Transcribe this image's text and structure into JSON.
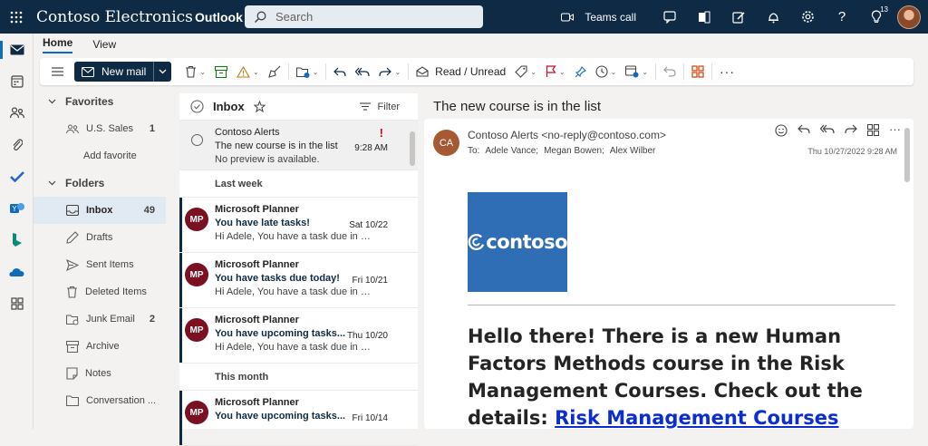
{
  "header": {
    "brand": "Contoso Electronics",
    "app": "Outlook",
    "search_placeholder": "Search",
    "teams_call": "Teams call",
    "notification_badge": "13"
  },
  "ribbon": {
    "tabs": [
      "Home",
      "View"
    ],
    "new_mail": "New mail",
    "read_unread": "Read / Unread"
  },
  "folders": {
    "favorites_label": "Favorites",
    "favorites": [
      {
        "label": "U.S. Sales",
        "count": "1"
      },
      {
        "label": "Add favorite",
        "count": ""
      }
    ],
    "folders_label": "Folders",
    "items": [
      {
        "label": "Inbox",
        "count": "49"
      },
      {
        "label": "Drafts",
        "count": ""
      },
      {
        "label": "Sent Items",
        "count": ""
      },
      {
        "label": "Deleted Items",
        "count": ""
      },
      {
        "label": "Junk Email",
        "count": "2"
      },
      {
        "label": "Archive",
        "count": ""
      },
      {
        "label": "Notes",
        "count": ""
      },
      {
        "label": "Conversation ...",
        "count": ""
      }
    ]
  },
  "message_list": {
    "title": "Inbox",
    "filter": "Filter",
    "selected": {
      "from": "Contoso Alerts",
      "subject": "The new course is in the list",
      "time": "9:28 AM",
      "preview": "No preview is available."
    },
    "group_last_week": "Last week",
    "group_this_month": "This month",
    "messages": [
      {
        "initials": "MP",
        "from": "Microsoft Planner",
        "subject": "You have late tasks!",
        "date": "Sat 10/22",
        "preview": "Hi Adele, You have a task due in Mic..."
      },
      {
        "initials": "MP",
        "from": "Microsoft Planner",
        "subject": "You have tasks due today!",
        "date": "Fri 10/21",
        "preview": "Hi Adele, You have a task due in Mic..."
      },
      {
        "initials": "MP",
        "from": "Microsoft Planner",
        "subject": "You have upcoming tasks...",
        "date": "Thu 10/20",
        "preview": "Hi Adele, You have a task due in Mic..."
      },
      {
        "initials": "MP",
        "from": "Microsoft Planner",
        "subject": "You have upcoming tasks...",
        "date": "Fri 10/14",
        "preview": ""
      }
    ]
  },
  "reading": {
    "subject": "The new course is in the list",
    "sender_initials": "CA",
    "from": "Contoso Alerts <no-reply@contoso.com>",
    "to_label": "To:",
    "recipients": [
      "Adele Vance;",
      "Megan Bowen;",
      "Alex Wilber"
    ],
    "date": "Thu 10/27/2022 9:28 AM",
    "logo_text": "contoso",
    "body": "Hello there! There is a new Human Factors Methods course in the Risk Management Courses. Check out the details:",
    "link": "Risk Management Courses"
  }
}
